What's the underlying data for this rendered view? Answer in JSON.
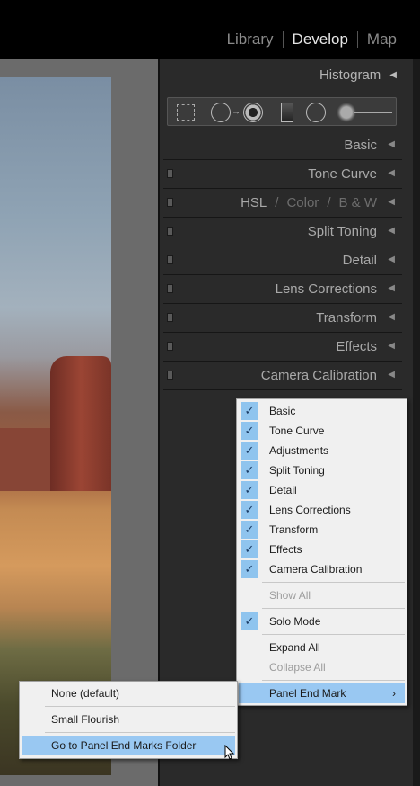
{
  "module_bar": {
    "modules": [
      {
        "label": "Library",
        "active": false
      },
      {
        "label": "Develop",
        "active": true
      },
      {
        "label": "Map",
        "active": false
      }
    ]
  },
  "histogram": {
    "label": "Histogram"
  },
  "tools": [
    "crop-overlay-icon",
    "spot-removal-icon",
    "red-eye-icon",
    "graduated-filter-icon",
    "radial-filter-icon",
    "adjustment-brush-icon"
  ],
  "panels": [
    {
      "label": "Basic",
      "switch": false
    },
    {
      "label": "Tone Curve",
      "switch": true
    },
    {
      "hsl": "HSL",
      "sep": "/",
      "color": "Color",
      "bw": "B & W",
      "switch": true
    },
    {
      "label": "Split Toning",
      "switch": true
    },
    {
      "label": "Detail",
      "switch": true
    },
    {
      "label": "Lens Corrections",
      "switch": true
    },
    {
      "label": "Transform",
      "switch": true
    },
    {
      "label": "Effects",
      "switch": true
    },
    {
      "label": "Camera Calibration",
      "switch": true
    }
  ],
  "context_menu": {
    "items": [
      "Basic",
      "Tone Curve",
      "Adjustments",
      "Split Toning",
      "Detail",
      "Lens Corrections",
      "Transform",
      "Effects",
      "Camera Calibration"
    ],
    "show_all": "Show All",
    "solo_mode": "Solo Mode",
    "expand_all": "Expand All",
    "collapse_all": "Collapse All",
    "panel_end_mark": "Panel End Mark",
    "check_glyph": "✓",
    "submenu_arrow": "›"
  },
  "submenu": {
    "none": "None (default)",
    "small_flourish": "Small Flourish",
    "goto_folder": "Go to Panel End Marks Folder"
  },
  "colors": {
    "highlight": "#99c8f2",
    "check_bg": "#8fc4ee",
    "panel_bg": "#2a2a2a"
  }
}
